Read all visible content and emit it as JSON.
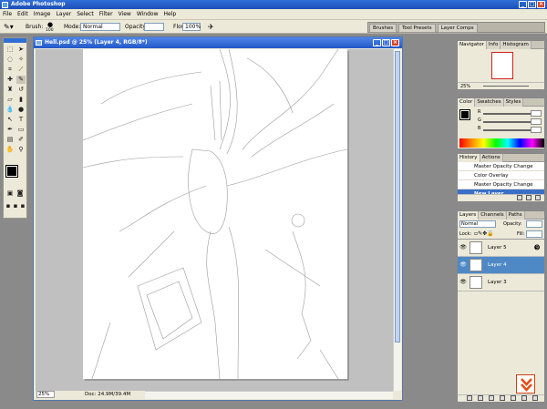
{
  "app": {
    "title": "Adobe Photoshop"
  },
  "menu": [
    "File",
    "Edit",
    "Image",
    "Layer",
    "Select",
    "Filter",
    "View",
    "Window",
    "Help"
  ],
  "options": {
    "brush_label": "Brush:",
    "brush_size": "100",
    "mode_label": "Mode:",
    "mode_value": "Normal",
    "opacity_label": "Opacity:",
    "opacity_value": "",
    "flow_label": "Flow:",
    "flow_value": "100%"
  },
  "palette_well": [
    "Brushes",
    "Tool Presets",
    "Layer Comps"
  ],
  "document": {
    "title": "Hell.psd @ 25% (Layer 4, RGB/8*)",
    "zoom": "25%",
    "doc_size": "Doc: 24.9M/39.4M"
  },
  "navigator": {
    "tabs": [
      "Navigator",
      "Info",
      "Histogram"
    ],
    "zoom": "25%"
  },
  "color": {
    "tabs": [
      "Color",
      "Swatches",
      "Styles"
    ],
    "channels": [
      {
        "label": "R",
        "value": ""
      },
      {
        "label": "G",
        "value": ""
      },
      {
        "label": "B",
        "value": ""
      }
    ],
    "fg": "#000000",
    "bg": "#ffffff"
  },
  "history": {
    "tabs": [
      "History",
      "Actions"
    ],
    "items": [
      "Master Opacity Change",
      "Color Overlay",
      "Master Opacity Change",
      "New Layer"
    ],
    "selected": 3
  },
  "layers": {
    "tabs": [
      "Layers",
      "Channels",
      "Paths"
    ],
    "mode": "Normal",
    "opacity_label": "Opacity:",
    "opacity_value": "",
    "lock_label": "Lock:",
    "fill_label": "Fill:",
    "fill_value": "",
    "rows": [
      {
        "name": "Layer 5",
        "selected": false
      },
      {
        "name": "Layer 4",
        "selected": true
      },
      {
        "name": "Layer 3",
        "selected": false
      }
    ]
  },
  "colors": {
    "title_bar": "#2358c8",
    "selected_layer": "#4e89c6",
    "history_selected": "#3a6fc8"
  }
}
